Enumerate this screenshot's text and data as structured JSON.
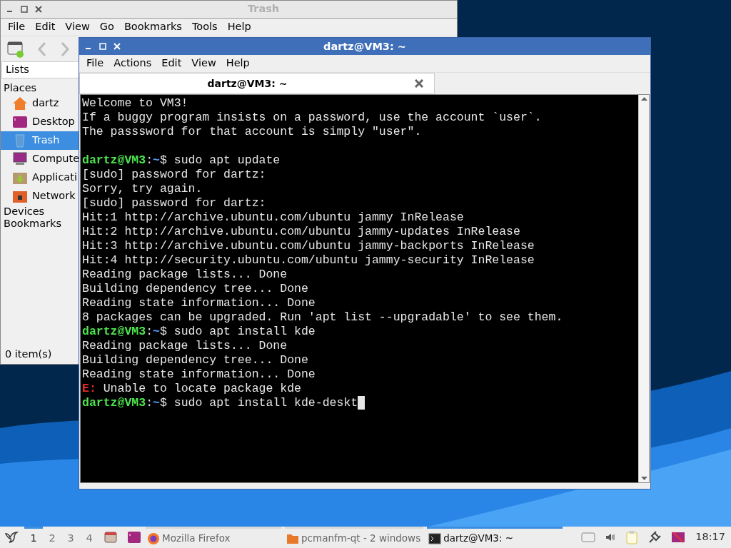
{
  "file_manager": {
    "title": "Trash",
    "menu": [
      "File",
      "Edit",
      "View",
      "Go",
      "Bookmarks",
      "Tools",
      "Help"
    ],
    "side_pane_mode": "Lists",
    "sections": [
      {
        "label": "Places",
        "items": [
          {
            "label": "dartz",
            "selected": false
          },
          {
            "label": "Desktop",
            "selected": false
          },
          {
            "label": "Trash",
            "selected": true
          },
          {
            "label": "Compute",
            "selected": false
          },
          {
            "label": "Applicati",
            "selected": false
          },
          {
            "label": "Network",
            "selected": false
          }
        ]
      },
      {
        "label": "Devices"
      },
      {
        "label": "Bookmarks"
      }
    ],
    "status": "0 item(s)"
  },
  "terminal": {
    "title": "dartz@VM3: ~",
    "menu": [
      "File",
      "Actions",
      "Edit",
      "View",
      "Help"
    ],
    "tabs": [
      {
        "label": "dartz@VM3: ~",
        "selected": true
      }
    ],
    "lines": [
      {
        "kind": "plain",
        "text": "Welcome to VM3!"
      },
      {
        "kind": "plain",
        "text": "If a buggy program insists on a password, use the account `user`."
      },
      {
        "kind": "plain",
        "text": "The passsword for that account is simply \"user\"."
      },
      {
        "kind": "blank"
      },
      {
        "kind": "prompt",
        "user": "dartz@VM3",
        "sep": ":",
        "path": "~",
        "command": "$ sudo apt update"
      },
      {
        "kind": "plain",
        "text": "[sudo] password for dartz:"
      },
      {
        "kind": "plain",
        "text": "Sorry, try again."
      },
      {
        "kind": "plain",
        "text": "[sudo] password for dartz:"
      },
      {
        "kind": "plain",
        "text": "Hit:1 http://archive.ubuntu.com/ubuntu jammy InRelease"
      },
      {
        "kind": "plain",
        "text": "Hit:2 http://archive.ubuntu.com/ubuntu jammy-updates InRelease"
      },
      {
        "kind": "plain",
        "text": "Hit:3 http://archive.ubuntu.com/ubuntu jammy-backports InRelease"
      },
      {
        "kind": "plain",
        "text": "Hit:4 http://security.ubuntu.com/ubuntu jammy-security InRelease"
      },
      {
        "kind": "plain",
        "text": "Reading package lists... Done"
      },
      {
        "kind": "plain",
        "text": "Building dependency tree... Done"
      },
      {
        "kind": "plain",
        "text": "Reading state information... Done"
      },
      {
        "kind": "plain",
        "text": "8 packages can be upgraded. Run 'apt list --upgradable' to see them."
      },
      {
        "kind": "prompt",
        "user": "dartz@VM3",
        "sep": ":",
        "path": "~",
        "command": "$ sudo apt install kde"
      },
      {
        "kind": "plain",
        "text": "Reading package lists... Done"
      },
      {
        "kind": "plain",
        "text": "Building dependency tree... Done"
      },
      {
        "kind": "plain",
        "text": "Reading state information... Done"
      },
      {
        "kind": "error",
        "prefix": "E:",
        "text": " Unable to locate package kde"
      },
      {
        "kind": "prompt",
        "user": "dartz@VM3",
        "sep": ":",
        "path": "~",
        "command": "$ sudo apt install kde-deskt",
        "cursor": true
      }
    ]
  },
  "taskbar": {
    "desktops": [
      {
        "label": "1",
        "selected": true
      },
      {
        "label": "2",
        "selected": false
      },
      {
        "label": "3",
        "selected": false
      },
      {
        "label": "4",
        "selected": false
      }
    ],
    "tasks": [
      {
        "label": "Mozilla Firefox",
        "selected": false
      },
      {
        "label": "pcmanfm-qt - 2 windows",
        "selected": false
      },
      {
        "label": "dartz@VM3: ~",
        "selected": true
      }
    ],
    "clock": "18:17"
  }
}
